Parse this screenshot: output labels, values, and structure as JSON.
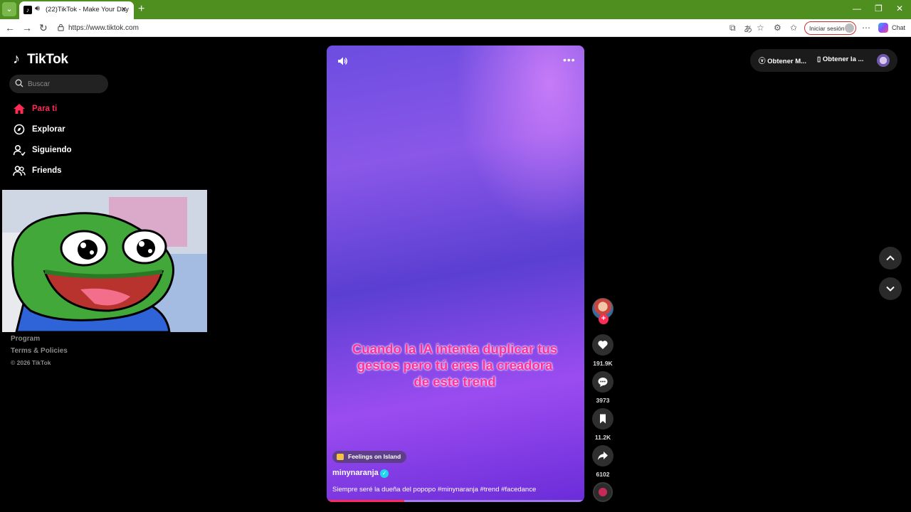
{
  "browser": {
    "tab_title": "(22)TikTok - Make Your Day",
    "url": "https://www.tiktok.com",
    "signin_label": "Iniciar sesión",
    "chat_label": "Chat"
  },
  "sidebar": {
    "logo_text": "TikTok",
    "search_placeholder": "Buscar",
    "items": [
      {
        "label": "Para ti",
        "icon": "home-icon",
        "active": true
      },
      {
        "label": "Explorar",
        "icon": "compass-icon",
        "active": false
      },
      {
        "label": "Siguiendo",
        "icon": "following-icon",
        "active": false
      },
      {
        "label": "Friends",
        "icon": "friends-icon",
        "active": false
      }
    ],
    "footer": {
      "program": "Program",
      "terms": "Terms & Policies",
      "copyright": "© 2026 TikTok"
    }
  },
  "video": {
    "caption_overlay": "Cuando la IA intenta duplicar tus gestos pero tú eres la creadora de este trend",
    "music": "Feelings on Island",
    "author": "minynaranja",
    "description": "Siempre seré la dueña del popopo #minynaranja #trend #facedance",
    "progress": 0.3
  },
  "actions": {
    "likes": "191.9K",
    "comments": "3973",
    "saves": "11.2K",
    "shares": "6102"
  },
  "top_right": {
    "get_coins": "Obtener M...",
    "get_app": "Obtener la ..."
  },
  "colors": {
    "accent": "#fe2c55",
    "titlebar": "#4e8f20",
    "caption": "#ff2f9a"
  }
}
